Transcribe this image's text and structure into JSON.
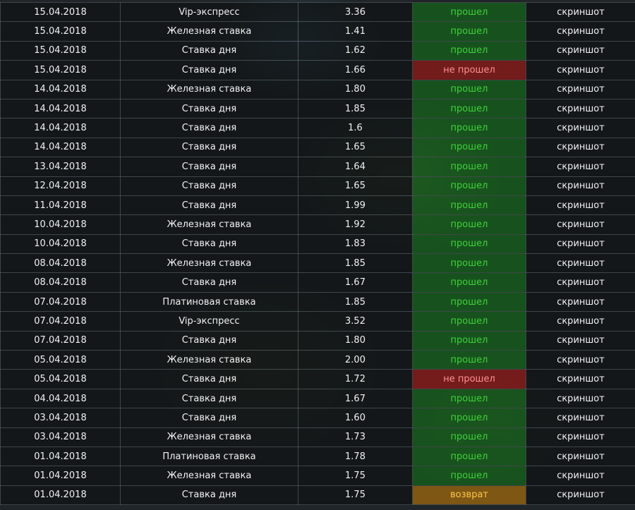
{
  "colors": {
    "win": "#3fd13a",
    "lose": "#ff8f8f",
    "return": "#ffc44a",
    "screenshot_link": "#c9ef3b"
  },
  "rows": [
    {
      "date": "15.04.2018",
      "type": "Vip-экспресс",
      "coef": "3.36",
      "result": "прошел",
      "status": "win",
      "screenshot": "скриншот"
    },
    {
      "date": "15.04.2018",
      "type": "Железная ставка",
      "coef": "1.41",
      "result": "прошел",
      "status": "win",
      "screenshot": "скриншот"
    },
    {
      "date": "15.04.2018",
      "type": "Ставка дня",
      "coef": "1.62",
      "result": "прошел",
      "status": "win",
      "screenshot": "скриншот"
    },
    {
      "date": "15.04.2018",
      "type": "Ставка дня",
      "coef": "1.66",
      "result": "не прошел",
      "status": "lose",
      "screenshot": "скриншот"
    },
    {
      "date": "14.04.2018",
      "type": "Железная ставка",
      "coef": "1.80",
      "result": "прошел",
      "status": "win",
      "screenshot": "скриншот"
    },
    {
      "date": "14.04.2018",
      "type": "Ставка дня",
      "coef": "1.85",
      "result": "прошел",
      "status": "win",
      "screenshot": "скриншот"
    },
    {
      "date": "14.04.2018",
      "type": "Ставка дня",
      "coef": "1.6",
      "result": "прошел",
      "status": "win",
      "screenshot": "скриншот"
    },
    {
      "date": "14.04.2018",
      "type": "Ставка дня",
      "coef": "1.65",
      "result": "прошел",
      "status": "win",
      "screenshot": "скриншот"
    },
    {
      "date": "13.04.2018",
      "type": "Ставка дня",
      "coef": "1.64",
      "result": "прошел",
      "status": "win",
      "screenshot": "скриншот"
    },
    {
      "date": "12.04.2018",
      "type": "Ставка дня",
      "coef": "1.65",
      "result": "прошел",
      "status": "win",
      "screenshot": "скриншот"
    },
    {
      "date": "11.04.2018",
      "type": "Ставка дня",
      "coef": "1.99",
      "result": "прошел",
      "status": "win",
      "screenshot": "скриншот"
    },
    {
      "date": "10.04.2018",
      "type": "Железная ставка",
      "coef": "1.92",
      "result": "прошел",
      "status": "win",
      "screenshot": "скриншот"
    },
    {
      "date": "10.04.2018",
      "type": "Ставка дня",
      "coef": "1.83",
      "result": "прошел",
      "status": "win",
      "screenshot": "скриншот"
    },
    {
      "date": "08.04.2018",
      "type": "Железная ставка",
      "coef": "1.85",
      "result": "прошел",
      "status": "win",
      "screenshot": "скриншот"
    },
    {
      "date": "08.04.2018",
      "type": "Ставка дня",
      "coef": "1.67",
      "result": "прошел",
      "status": "win",
      "screenshot": "скриншот"
    },
    {
      "date": "07.04.2018",
      "type": "Платиновая ставка",
      "coef": "1.85",
      "result": "прошел",
      "status": "win",
      "screenshot": "скриншот"
    },
    {
      "date": "07.04.2018",
      "type": "Vip-экспресс",
      "coef": "3.52",
      "result": "прошел",
      "status": "win",
      "screenshot": "скриншот"
    },
    {
      "date": "07.04.2018",
      "type": "Ставка дня",
      "coef": "1.80",
      "result": "прошел",
      "status": "win",
      "screenshot": "скриншот"
    },
    {
      "date": "05.04.2018",
      "type": "Железная ставка",
      "coef": "2.00",
      "result": "прошел",
      "status": "win",
      "screenshot": "скриншот"
    },
    {
      "date": "05.04.2018",
      "type": "Ставка дня",
      "coef": "1.72",
      "result": "не прошел",
      "status": "lose",
      "screenshot": "скриншот"
    },
    {
      "date": "04.04.2018",
      "type": "Ставка дня",
      "coef": "1.67",
      "result": "прошел",
      "status": "win",
      "screenshot": "скриншот"
    },
    {
      "date": "03.04.2018",
      "type": "Ставка дня",
      "coef": "1.60",
      "result": "прошел",
      "status": "win",
      "screenshot": "скриншот"
    },
    {
      "date": "03.04.2018",
      "type": "Железная ставка",
      "coef": "1.73",
      "result": "прошел",
      "status": "win",
      "screenshot": "скриншот"
    },
    {
      "date": "01.04.2018",
      "type": "Платиновая ставка",
      "coef": "1.78",
      "result": "прошел",
      "status": "win",
      "screenshot": "скриншот"
    },
    {
      "date": "01.04.2018",
      "type": "Железная ставка",
      "coef": "1.75",
      "result": "прошел",
      "status": "win",
      "screenshot": "скриншот"
    },
    {
      "date": "01.04.2018",
      "type": "Ставка дня",
      "coef": "1.75",
      "result": "возврат",
      "status": "return",
      "screenshot": "скриншот"
    }
  ]
}
